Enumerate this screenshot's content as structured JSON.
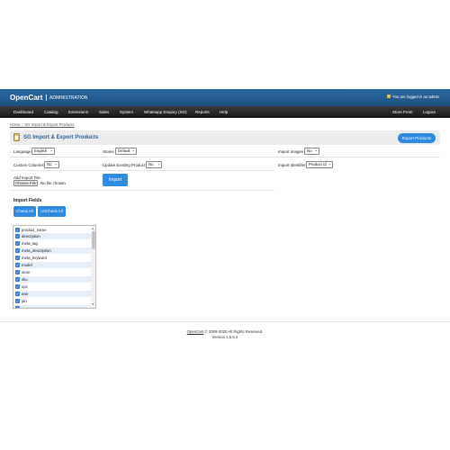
{
  "header": {
    "logo": "OpenCart",
    "subtitle": "ADMINISTRATION",
    "logged_in": "You are logged in as admin"
  },
  "nav": {
    "items": [
      "Dashboard",
      "Catalog",
      "Extensions",
      "Sales",
      "System",
      "Whatsapp Enquiry (SG)",
      "Reports",
      "Help"
    ],
    "store_front": "Store Front",
    "logout": "Logout"
  },
  "breadcrumb": "Home :: SG Import & Export Products",
  "panel": {
    "title": "SG Import & Export Products",
    "export_button": "Export Products"
  },
  "form": {
    "language": {
      "label": "Language",
      "value": "English"
    },
    "stores": {
      "label": "Stores",
      "value": "Default"
    },
    "import_images": {
      "label": "Import Images",
      "value": "No"
    },
    "custom_columns": {
      "label": "Custom Columns",
      "value": "No"
    },
    "update_existing": {
      "label": "Update Existing Product",
      "value": "No"
    },
    "import_identifier": {
      "label": "Import Identifier",
      "value": "Product Id"
    },
    "add_import_file": {
      "label": "Add Import File"
    },
    "choose_file": "Choose File",
    "no_file": "No file chosen",
    "import_button": "Import"
  },
  "import_fields": {
    "title": "Import Fields",
    "check_all": "Check All",
    "uncheck_all": "UnCheck All",
    "items": [
      "product_name",
      "description",
      "meta_tag",
      "meta_description",
      "meta_keyword",
      "model",
      "store",
      "sku",
      "upc",
      "ean",
      "jan"
    ]
  },
  "footer": {
    "brand": "OpenCart",
    "copyright": "© 2009-2020 All Rights Reserved.",
    "version": "Version 1.5.6.4"
  },
  "colors": {
    "header": "#1e4f80",
    "nav": "#222222",
    "accent": "#2f8be0",
    "lock": "#f3c12d"
  }
}
